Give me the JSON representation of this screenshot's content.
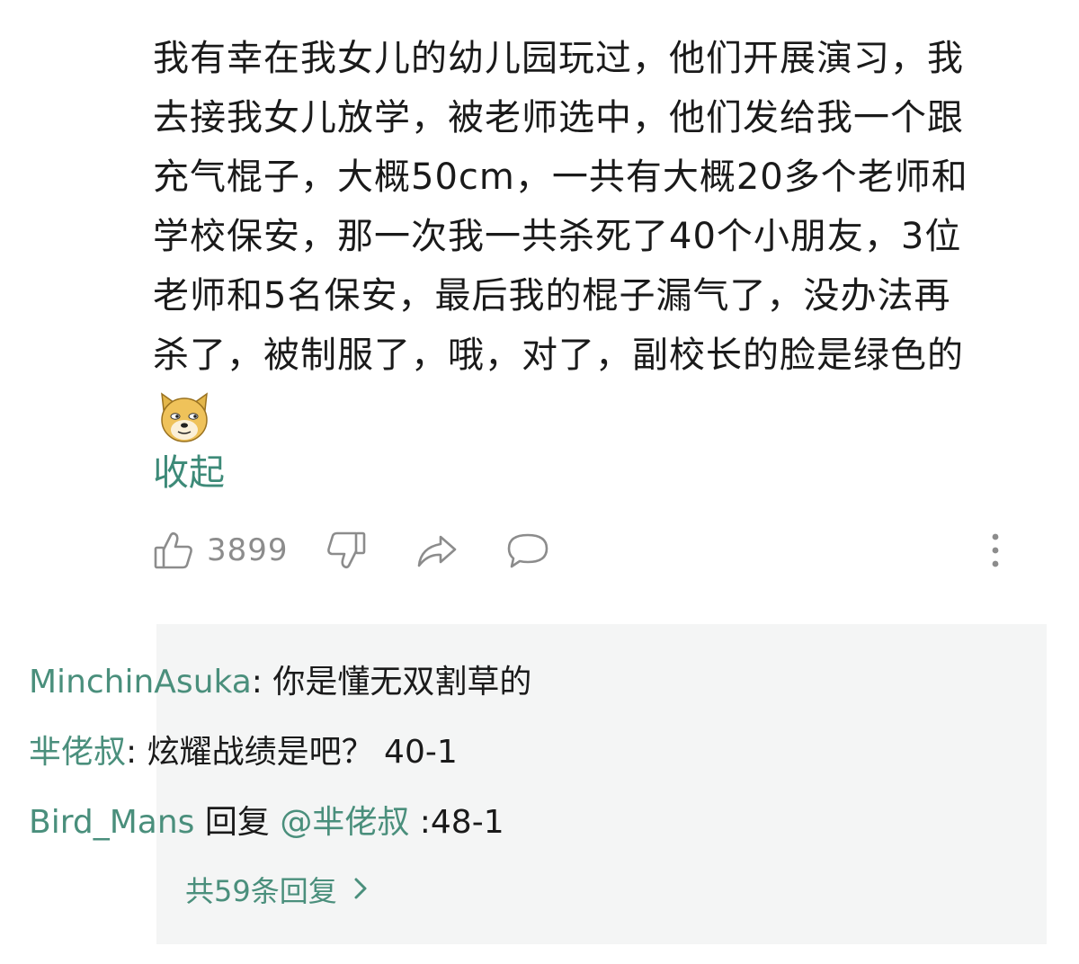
{
  "comment": {
    "lines": [
      "我有幸在我女儿的幼儿园玩过，他们开展演习，我",
      "去接我女儿放学，被老师选中，他们发给我一个跟",
      "充气棍子，大概50cm，一共有大概20多个老师和",
      "学校保安，那一次我一共杀死了40个小朋友，3位",
      "老师和5名保安，最后我的棍子漏气了，没办法再",
      "杀了，被制服了，哦，对了，副校长的脸是绿色的"
    ],
    "emoji": "doge-emoji",
    "collapse_label": "收起"
  },
  "actions": {
    "like_count": "3899",
    "icons": [
      "thumbs-up-icon",
      "thumbs-down-icon",
      "share-icon",
      "comment-icon",
      "more-vertical-icon"
    ]
  },
  "replies": [
    {
      "author": "MinchinAsuka",
      "separator": ": ",
      "text": "你是懂无双割草的"
    },
    {
      "author": "芈佬叔",
      "separator": ": ",
      "text": "炫耀战绩是吧？ 40-1"
    },
    {
      "author": "Bird_Mans",
      "reply_word": " 回复 ",
      "mention": "@芈佬叔",
      "text": " :48-1"
    }
  ],
  "more_replies_label": "共59条回复",
  "colors": {
    "accent": "#4a8f7c",
    "reply_bg": "#f4f5f5",
    "icon": "#8c8c8c"
  }
}
